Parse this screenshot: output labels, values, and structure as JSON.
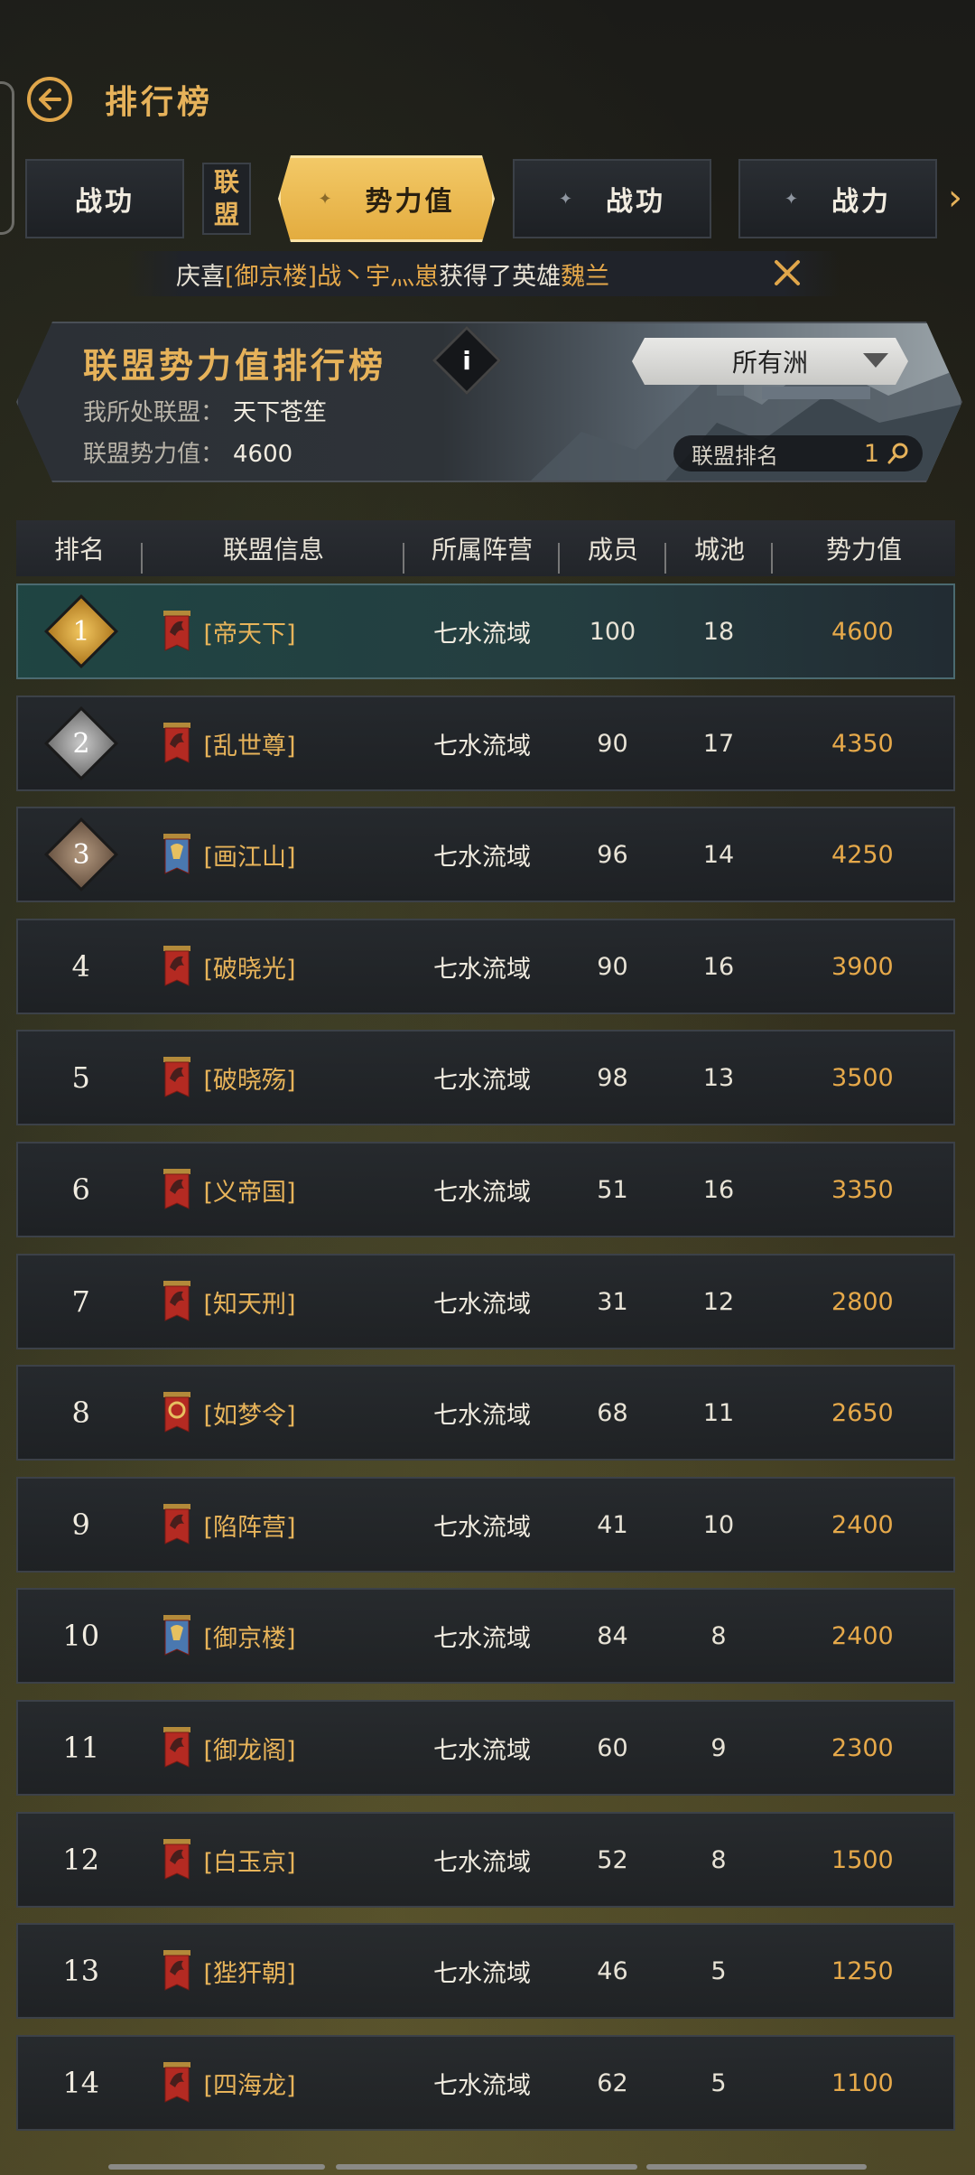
{
  "header": {
    "title": "排行榜"
  },
  "tabs": {
    "items": [
      {
        "label": "战功"
      },
      {
        "label": "势力值"
      },
      {
        "label": "战功"
      },
      {
        "label": "战力"
      }
    ],
    "alliance_line1": "联",
    "alliance_line2": "盟",
    "active_index": 1
  },
  "announcement": {
    "prefix": "庆喜",
    "alliance": "[御京楼]",
    "player": "战丶宇灬崽",
    "middle": "获得了英雄",
    "hero": "魏兰"
  },
  "banner": {
    "title": "联盟势力值排行榜",
    "my_alliance_label": "我所处联盟：",
    "my_alliance_value": "天下苍笙",
    "power_label": "联盟势力值：",
    "power_value": "4600",
    "region_selected": "所有洲",
    "rank_label": "联盟排名",
    "rank_value": "1",
    "info_label": "i"
  },
  "table": {
    "headers": [
      "排名",
      "联盟信息",
      "所属阵营",
      "成员",
      "城池",
      "势力值"
    ],
    "rows": [
      {
        "rank": "1",
        "name": "[帝天下]",
        "camp": "七水流域",
        "members": "100",
        "cities": "18",
        "power": "4600",
        "flag": "red"
      },
      {
        "rank": "2",
        "name": "[乱世尊]",
        "camp": "七水流域",
        "members": "90",
        "cities": "17",
        "power": "4350",
        "flag": "red"
      },
      {
        "rank": "3",
        "name": "[画江山]",
        "camp": "七水流域",
        "members": "96",
        "cities": "14",
        "power": "4250",
        "flag": "blue"
      },
      {
        "rank": "4",
        "name": "[破晓光]",
        "camp": "七水流域",
        "members": "90",
        "cities": "16",
        "power": "3900",
        "flag": "red"
      },
      {
        "rank": "5",
        "name": "[破晓殇]",
        "camp": "七水流域",
        "members": "98",
        "cities": "13",
        "power": "3500",
        "flag": "red"
      },
      {
        "rank": "6",
        "name": "[义帝国]",
        "camp": "七水流域",
        "members": "51",
        "cities": "16",
        "power": "3350",
        "flag": "red"
      },
      {
        "rank": "7",
        "name": "[知天刑]",
        "camp": "七水流域",
        "members": "31",
        "cities": "12",
        "power": "2800",
        "flag": "red"
      },
      {
        "rank": "8",
        "name": "[如梦令]",
        "camp": "七水流域",
        "members": "68",
        "cities": "11",
        "power": "2650",
        "flag": "red-ring"
      },
      {
        "rank": "9",
        "name": "[陷阵营]",
        "camp": "七水流域",
        "members": "41",
        "cities": "10",
        "power": "2400",
        "flag": "red"
      },
      {
        "rank": "10",
        "name": "[御京楼]",
        "camp": "七水流域",
        "members": "84",
        "cities": "8",
        "power": "2400",
        "flag": "blue"
      },
      {
        "rank": "11",
        "name": "[御龙阁]",
        "camp": "七水流域",
        "members": "60",
        "cities": "9",
        "power": "2300",
        "flag": "red"
      },
      {
        "rank": "12",
        "name": "[白玉京]",
        "camp": "七水流域",
        "members": "52",
        "cities": "8",
        "power": "1500",
        "flag": "red"
      },
      {
        "rank": "13",
        "name": "[狴犴朝]",
        "camp": "七水流域",
        "members": "46",
        "cities": "5",
        "power": "1250",
        "flag": "red"
      },
      {
        "rank": "14",
        "name": "[四海龙]",
        "camp": "七水流域",
        "members": "62",
        "cities": "5",
        "power": "1100",
        "flag": "red"
      }
    ]
  },
  "colors": {
    "accent": "#e6b25a",
    "power": "#e6a94a",
    "flag_red": "#b42a22",
    "flag_blue": "#4a78b0"
  }
}
